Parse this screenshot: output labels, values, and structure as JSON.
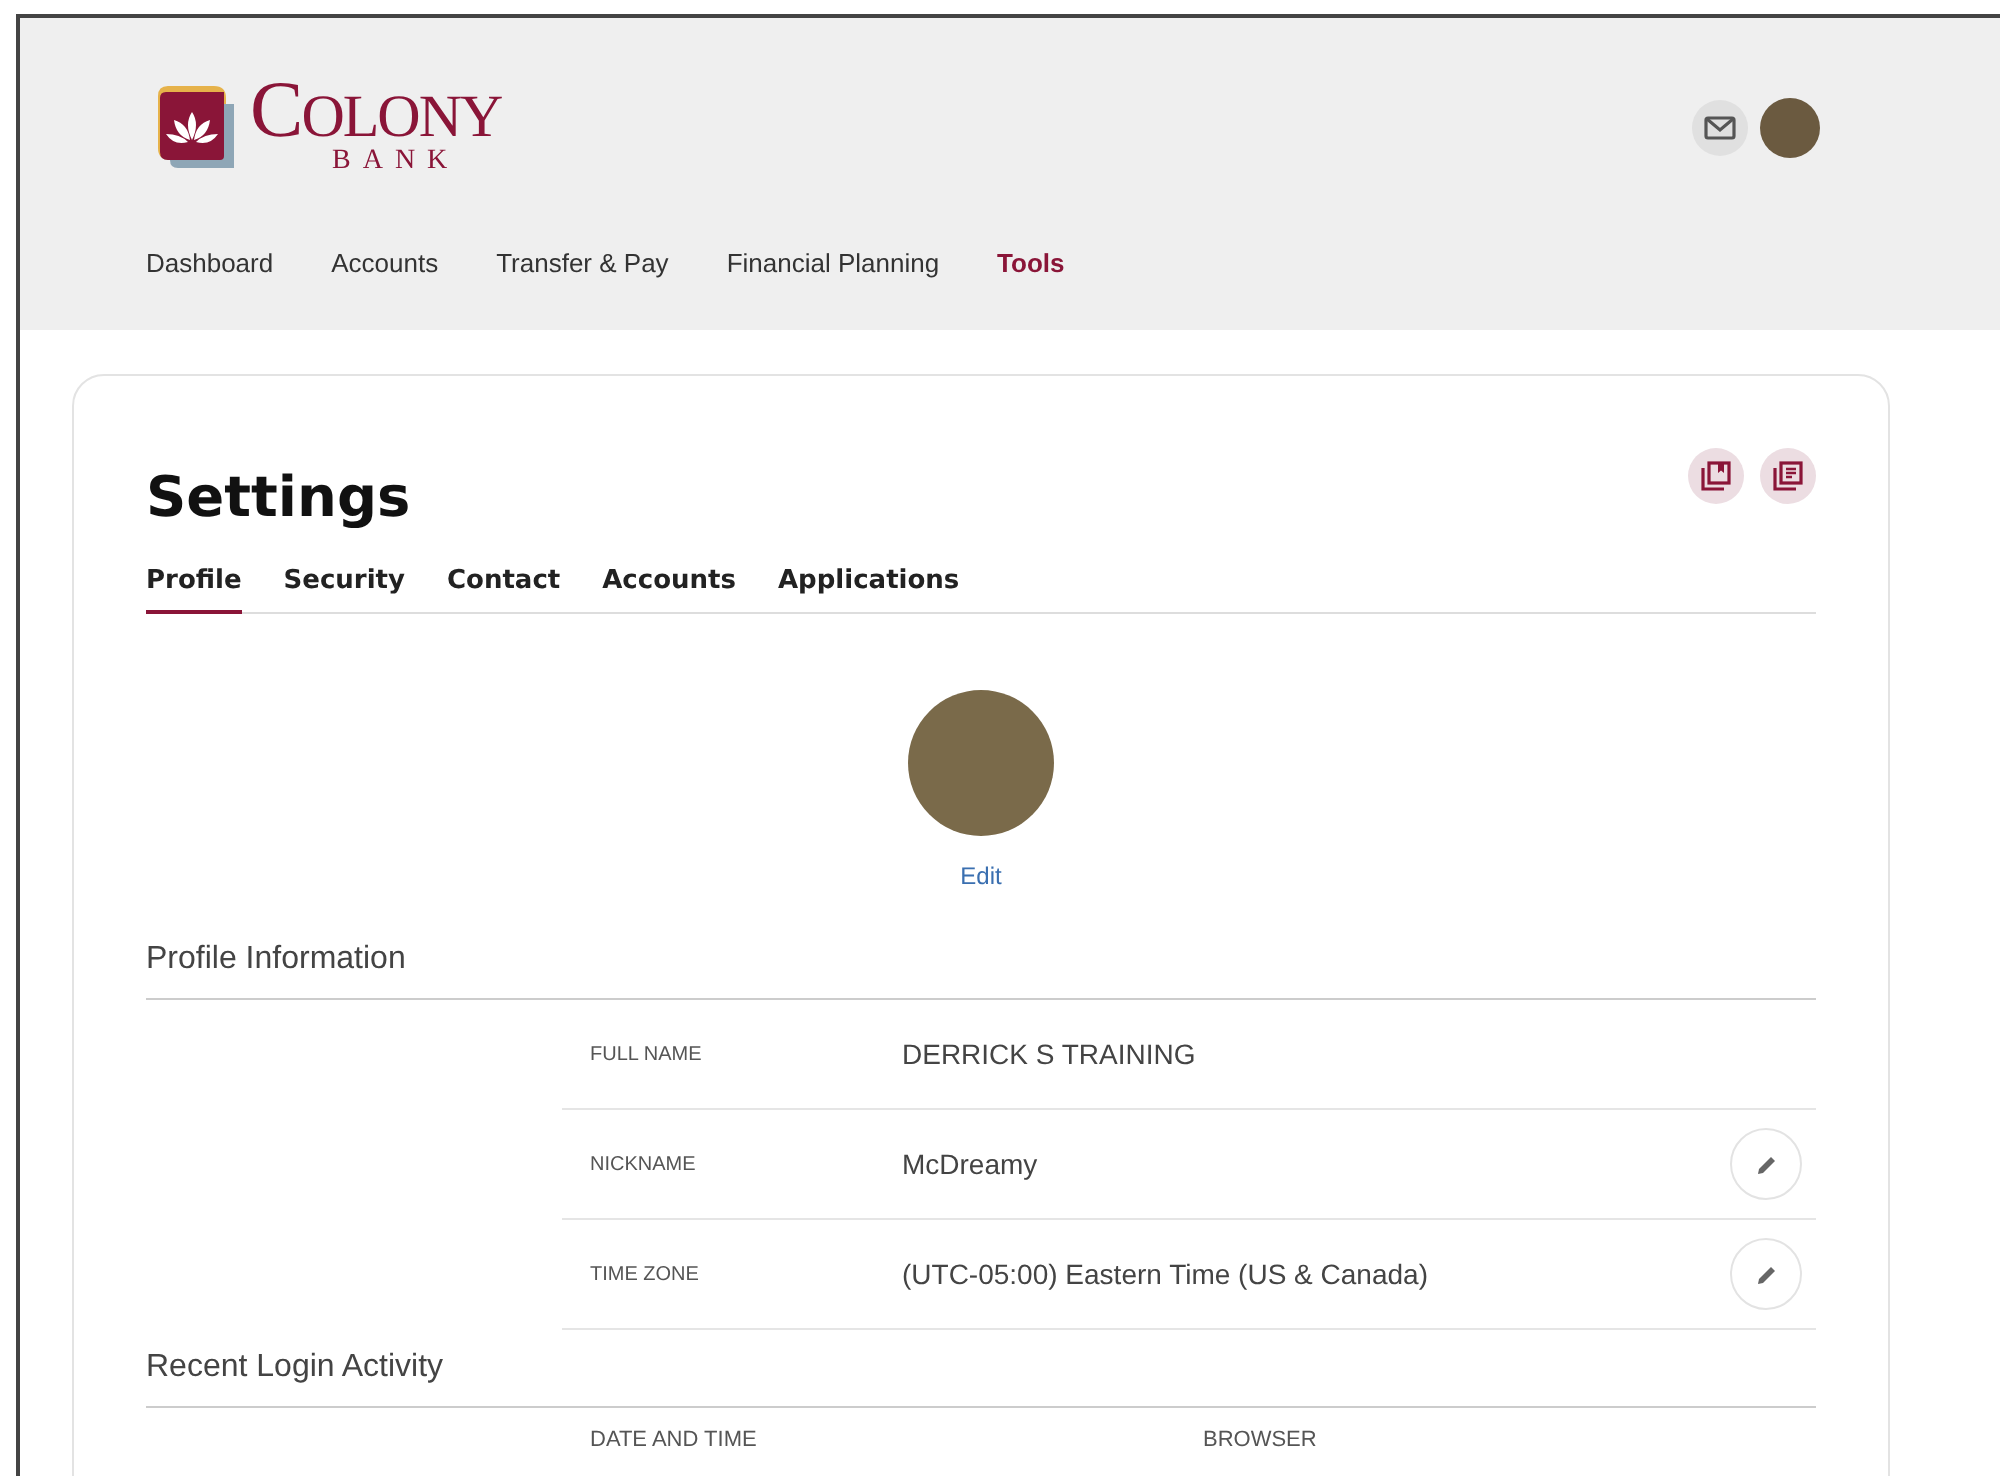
{
  "header": {
    "logo": {
      "name": "COLONY",
      "subtitle": "BANK"
    }
  },
  "nav": [
    {
      "label": "Dashboard",
      "selected": false
    },
    {
      "label": "Accounts",
      "selected": false
    },
    {
      "label": "Transfer & Pay",
      "selected": false
    },
    {
      "label": "Financial Planning",
      "selected": false
    },
    {
      "label": "Tools",
      "selected": true
    }
  ],
  "page": {
    "title": "Settings",
    "tabs": [
      {
        "label": "Profile",
        "selected": true
      },
      {
        "label": "Security",
        "selected": false
      },
      {
        "label": "Contact",
        "selected": false
      },
      {
        "label": "Accounts",
        "selected": false
      },
      {
        "label": "Applications",
        "selected": false
      }
    ]
  },
  "profile": {
    "photo_action": "Edit",
    "section_title": "Profile Information",
    "fields": [
      {
        "label": "FULL NAME",
        "value": "DERRICK S TRAINING",
        "editable": false
      },
      {
        "label": "NICKNAME",
        "value": "McDreamy",
        "editable": true
      },
      {
        "label": "TIME ZONE",
        "value": "(UTC-05:00) Eastern Time (US & Canada)",
        "editable": true
      }
    ]
  },
  "login_activity": {
    "title": "Recent Login Activity",
    "columns": [
      "DATE AND TIME",
      "BROWSER"
    ]
  }
}
